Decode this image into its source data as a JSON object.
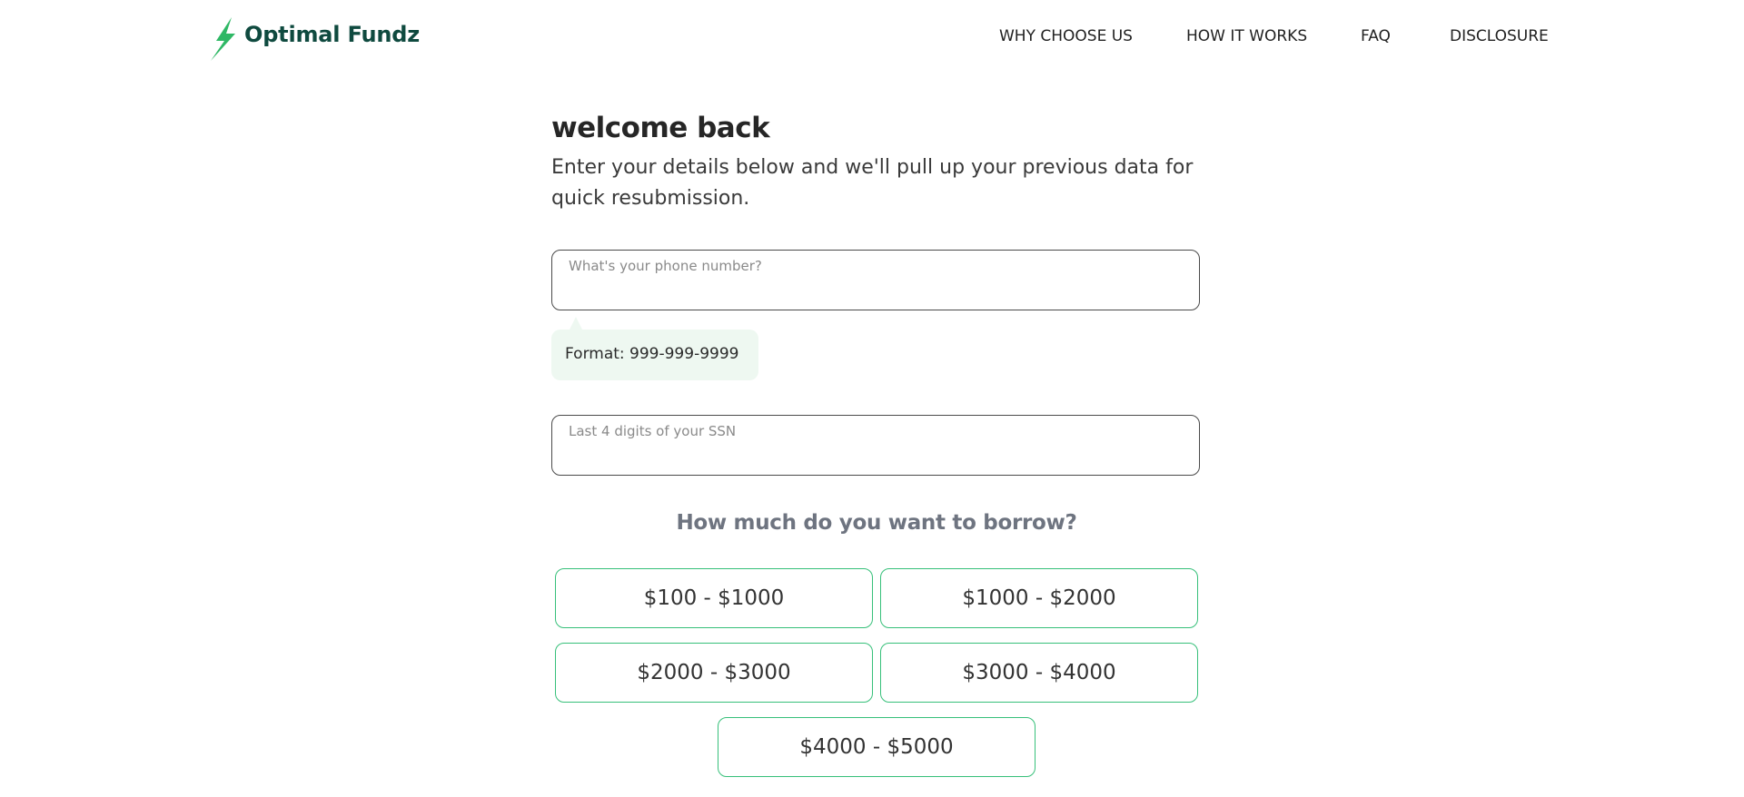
{
  "header": {
    "logo_text": "Optimal Fundz",
    "brand_color": "#0f4a3f",
    "bolt_color": "#2fb865",
    "nav": [
      {
        "label": "WHY CHOOSE US"
      },
      {
        "label": "HOW IT WORKS"
      },
      {
        "label": "FAQ"
      },
      {
        "label": "DISCLOSURE"
      }
    ]
  },
  "main": {
    "title": "welcome back",
    "subtitle": "Enter your details below and we'll pull up your previous data for quick resubmission.",
    "phone_field": {
      "label": "What's your phone number?",
      "value": ""
    },
    "phone_hint": "Format: 999-999-9999",
    "ssn_field": {
      "label": "Last 4 digits of your SSN",
      "value": ""
    },
    "borrow_title": "How much do you want to borrow?",
    "amounts": [
      {
        "label": "$100 - $1000"
      },
      {
        "label": "$1000 - $2000"
      },
      {
        "label": "$2000 - $3000"
      },
      {
        "label": "$3000 - $4000"
      },
      {
        "label": "$4000 - $5000"
      }
    ],
    "accent_color": "#37c07a"
  }
}
